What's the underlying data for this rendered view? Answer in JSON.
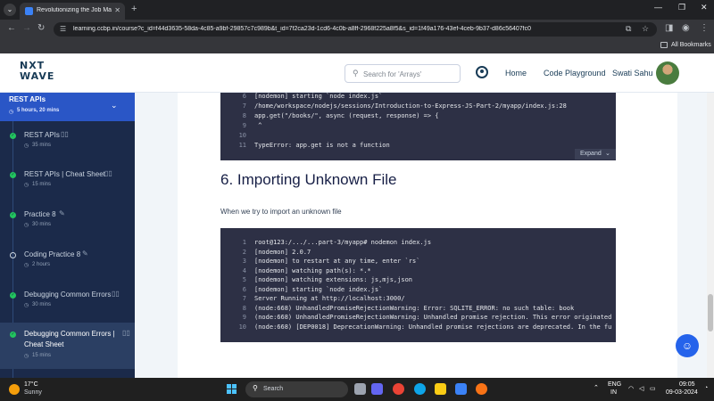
{
  "browser": {
    "tab_title": "Revolutionizing the Job Market",
    "url": "learning.ccbp.in/course?c_id=f44d3635-58da-4c85-a9bf-29857c7c989b&t_id=7f2ca23d-1cd6-4c0b-a8ff-2968f225a8f5&s_id=1f49a176-43ef-4ceb-9b37-d86c56407fc0",
    "bookmarks_label": "All Bookmarks"
  },
  "header": {
    "logo_line1": "NXT",
    "logo_line2": "WAVE",
    "search_placeholder": "Search for 'Arrays'",
    "nav_home": "Home",
    "nav_playground": "Code Playground",
    "user_name": "Swati Sahu"
  },
  "sidebar": {
    "title": "REST APIs",
    "duration": "5 hours, 20 mins",
    "items": [
      {
        "label": "REST APIs",
        "time": "35 mins",
        "icon": "book-icon",
        "status": "completed"
      },
      {
        "label": "REST APIs | Cheat Sheet",
        "time": "15 mins",
        "icon": "book-icon",
        "status": "completed"
      },
      {
        "label": "Practice 8",
        "time": "30 mins",
        "icon": "pencil-icon",
        "status": "completed"
      },
      {
        "label": "Coding Practice 8",
        "time": "2 hours",
        "icon": "pencil-icon",
        "status": "not-started"
      },
      {
        "label": "Debugging Common Errors",
        "time": "30 mins",
        "icon": "book-icon",
        "status": "completed"
      },
      {
        "label": "Debugging Common Errors | Cheat Sheet",
        "time": "15 mins",
        "icon": "book-icon",
        "status": "completed"
      }
    ]
  },
  "content": {
    "code_block_1": [
      {
        "n": "6",
        "t": "[nodemon] starting `node index.js`"
      },
      {
        "n": "7",
        "t": "/home/workspace/nodejs/sessions/Introduction-to-Express-JS-Part-2/myapp/index.js:28"
      },
      {
        "n": "8",
        "t": "app.get(\"/books/\", async (request, response) => {"
      },
      {
        "n": "9",
        "t": "    ^"
      },
      {
        "n": "10",
        "t": ""
      },
      {
        "n": "11",
        "t": "TypeError: app.get is not a function"
      }
    ],
    "expand_label": "Expand",
    "heading": "6. Importing Unknown File",
    "paragraph": "When we try to import an unknown file",
    "code_block_2": [
      {
        "n": "1",
        "t": "root@123:/.../...part-3/myapp# nodemon index.js"
      },
      {
        "n": "2",
        "t": "[nodemon] 2.0.7"
      },
      {
        "n": "3",
        "t": "[nodemon] to restart at any time, enter `rs`"
      },
      {
        "n": "4",
        "t": "[nodemon] watching path(s): *.*"
      },
      {
        "n": "5",
        "t": "[nodemon] watching extensions: js,mjs,json"
      },
      {
        "n": "6",
        "t": "[nodemon] starting `node index.js`"
      },
      {
        "n": "7",
        "t": "Server Running at http://localhost:3000/"
      },
      {
        "n": "8",
        "t": "(node:668) UnhandledPromiseRejectionWarning: Error: SQLITE_ERROR: no such table: book"
      },
      {
        "n": "9",
        "t": "(node:668) UnhandledPromiseRejectionWarning: Unhandled promise rejection. This error originated"
      },
      {
        "n": "10",
        "t": "(node:668) [DEP0018] DeprecationWarning: Unhandled promise rejections are deprecated. In the fu"
      }
    ]
  },
  "taskbar": {
    "temperature": "17°C",
    "weather": "Sunny",
    "search_label": "Search",
    "lang_line1": "ENG",
    "lang_line2": "IN",
    "time": "09:05",
    "date": "09-03-2024"
  },
  "colors": {
    "sidebar_bg": "#1b2a4a",
    "sidebar_header": "#2a56c6",
    "code_bg": "#2d3045",
    "completed": "#22c55e",
    "brand_text": "#183b56"
  }
}
